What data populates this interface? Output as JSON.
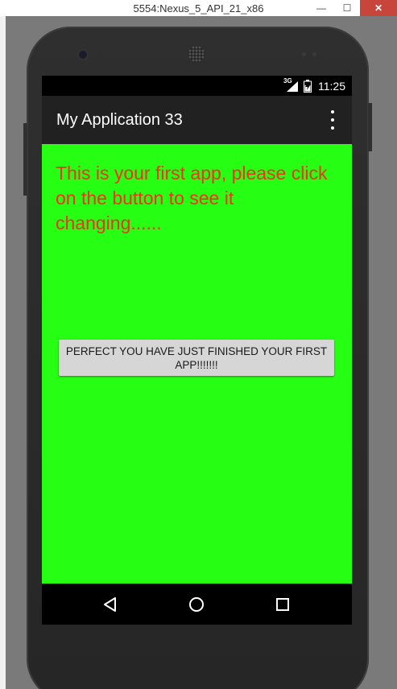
{
  "window": {
    "title": "5554:Nexus_5_API_21_x86",
    "controls": [
      "minimize",
      "maximize",
      "close"
    ]
  },
  "status_bar": {
    "network": "3G",
    "time": "11:25",
    "icons": [
      "signal-icon",
      "battery-icon"
    ]
  },
  "app_bar": {
    "title": "My Application 33",
    "menu_icon": "overflow-menu-icon"
  },
  "content": {
    "message": "This is your first app, please click on the button to see it changing......",
    "button_label": "PERFECT YOU HAVE JUST FINISHED YOUR FIRST APP!!!!!!!"
  },
  "nav_bar": {
    "buttons": [
      "back-icon",
      "home-icon",
      "recents-icon"
    ]
  },
  "colors": {
    "content_background": "#26ff14",
    "message_text": "#f2321d",
    "app_bar": "#212121",
    "button": "#d6d6d6"
  }
}
